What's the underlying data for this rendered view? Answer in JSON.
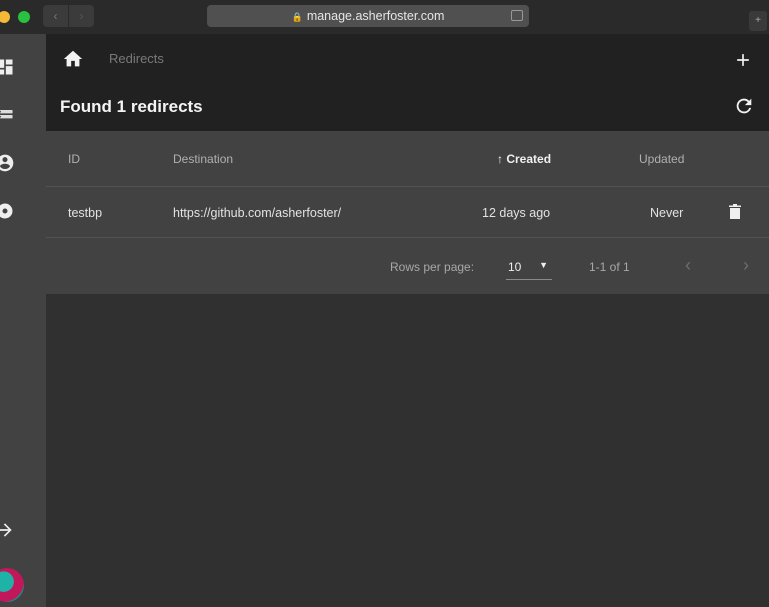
{
  "browser": {
    "url": "manage.asherfoster.com",
    "nav_back": "‹",
    "nav_forward": "›",
    "lock_icon": "lock-icon"
  },
  "sidebar": {
    "items": [
      {
        "icon": "dashboard-icon"
      },
      {
        "icon": "redirects-icon"
      },
      {
        "icon": "account-icon"
      },
      {
        "icon": "settings-icon"
      },
      {
        "icon": "logout-icon"
      }
    ],
    "avatar_colors": [
      "#1fb3a8",
      "#c2185b"
    ]
  },
  "appbar": {
    "breadcrumb": "Redirects",
    "title": "Found 1 redirects",
    "home_icon": "home-icon",
    "add_icon": "add-icon",
    "refresh_icon": "refresh-icon"
  },
  "table": {
    "columns": {
      "id": "ID",
      "destination": "Destination",
      "created": "Created",
      "updated": "Updated"
    },
    "sort_indicator": "↑",
    "rows": [
      {
        "id": "testbp",
        "destination": "https://github.com/asherfoster/",
        "created": "12 days ago",
        "updated": "Never"
      }
    ],
    "footer": {
      "rows_per_page_label": "Rows per page:",
      "rows_per_page_value": "10",
      "range": "1-1 of 1",
      "prev": "‹",
      "next": "›"
    }
  },
  "colors": {
    "background": "#303030",
    "appbar": "#212121",
    "surface": "#424242"
  }
}
